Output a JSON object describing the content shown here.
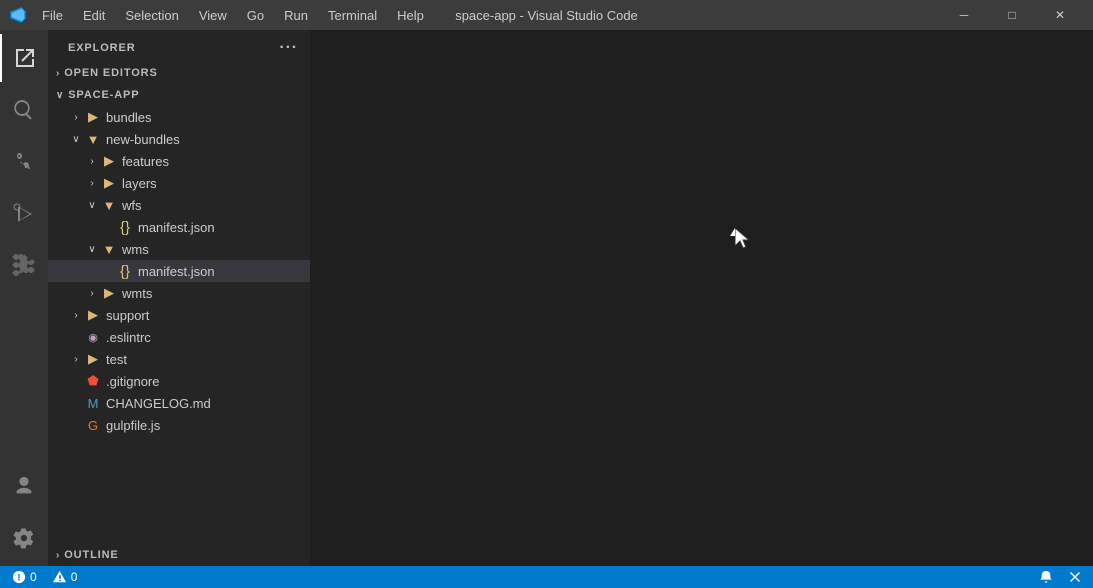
{
  "titlebar": {
    "title": "space-app - Visual Studio Code",
    "menu": [
      "File",
      "Edit",
      "Selection",
      "View",
      "Go",
      "Run",
      "Terminal",
      "Help"
    ],
    "min_label": "─",
    "max_label": "□",
    "close_label": "✕"
  },
  "activity_bar": {
    "items": [
      {
        "name": "explorer",
        "icon": "⧉",
        "active": true
      },
      {
        "name": "search",
        "icon": "🔍"
      },
      {
        "name": "source-control",
        "icon": "⎇"
      },
      {
        "name": "run-debug",
        "icon": "▷"
      },
      {
        "name": "extensions",
        "icon": "⊞"
      }
    ],
    "bottom_items": [
      {
        "name": "accounts",
        "icon": "👤"
      },
      {
        "name": "settings",
        "icon": "⚙"
      }
    ]
  },
  "sidebar": {
    "header": "EXPLORER",
    "more_label": "···",
    "sections": {
      "open_editors": {
        "label": "OPEN EDITORS",
        "collapsed": true
      },
      "space_app": {
        "label": "SPACE-APP",
        "expanded": true
      }
    },
    "tree": [
      {
        "id": "open-editors",
        "label": "OPEN EDITORS",
        "indent": 0,
        "chevron": "›",
        "type": "section"
      },
      {
        "id": "space-app",
        "label": "SPACE-APP",
        "indent": 0,
        "chevron": "∨",
        "type": "section"
      },
      {
        "id": "bundles",
        "label": "bundles",
        "indent": 1,
        "chevron": "›",
        "type": "folder"
      },
      {
        "id": "new-bundles",
        "label": "new-bundles",
        "indent": 1,
        "chevron": "∨",
        "type": "folder-open"
      },
      {
        "id": "features",
        "label": "features",
        "indent": 2,
        "chevron": "›",
        "type": "folder"
      },
      {
        "id": "layers",
        "label": "layers",
        "indent": 2,
        "chevron": "›",
        "type": "folder"
      },
      {
        "id": "wfs",
        "label": "wfs",
        "indent": 2,
        "chevron": "∨",
        "type": "folder-open"
      },
      {
        "id": "wfs-manifest",
        "label": "manifest.json",
        "indent": 3,
        "chevron": "",
        "type": "json"
      },
      {
        "id": "wms",
        "label": "wms",
        "indent": 2,
        "chevron": "∨",
        "type": "folder-open"
      },
      {
        "id": "wms-manifest",
        "label": "manifest.json",
        "indent": 3,
        "chevron": "",
        "type": "json",
        "selected": true
      },
      {
        "id": "wmts",
        "label": "wmts",
        "indent": 2,
        "chevron": "›",
        "type": "folder"
      },
      {
        "id": "support",
        "label": "support",
        "indent": 1,
        "chevron": "›",
        "type": "folder"
      },
      {
        "id": "eslintrc",
        "label": ".eslintrc",
        "indent": 1,
        "chevron": "",
        "type": "eslint"
      },
      {
        "id": "test",
        "label": "test",
        "indent": 1,
        "chevron": "›",
        "type": "folder"
      },
      {
        "id": "gitignore",
        "label": ".gitignore",
        "indent": 1,
        "chevron": "",
        "type": "git"
      },
      {
        "id": "changelog",
        "label": "CHANGELOG.md",
        "indent": 1,
        "chevron": "",
        "type": "md"
      },
      {
        "id": "gulpfile",
        "label": "gulpfile.js",
        "indent": 1,
        "chevron": "",
        "type": "js"
      }
    ],
    "outline_label": "OUTLINE"
  },
  "status_bar": {
    "left_items": [
      {
        "id": "errors",
        "icon": "⊗",
        "value": "0"
      },
      {
        "id": "warnings",
        "icon": "⚠",
        "value": "0"
      }
    ],
    "right_items": [
      {
        "id": "notifications",
        "icon": "🔔"
      },
      {
        "id": "no-problems",
        "icon": "✕"
      }
    ]
  },
  "colors": {
    "accent": "#007acc",
    "sidebar_bg": "#252526",
    "editor_bg": "#1e1e1e",
    "activity_bg": "#333333",
    "titlebar_bg": "#3c3c3c",
    "selected_row": "#37373d",
    "json_icon": "#e2c27d",
    "js_icon": "#cbcb41",
    "md_icon": "#519aba",
    "git_icon": "#9c9c9c",
    "eslint_icon": "#c99cca",
    "folder_icon": "#dcb67a",
    "folder_open_icon": "#dcb67a"
  }
}
